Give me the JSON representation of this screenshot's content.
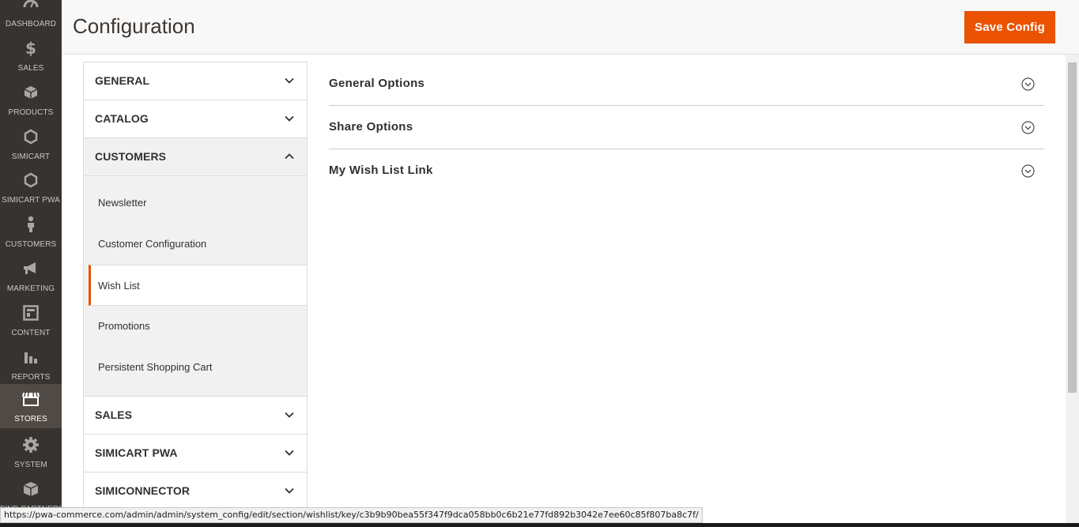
{
  "nav": {
    "items": [
      {
        "label": "DASHBOARD",
        "icon": "dashboard-icon"
      },
      {
        "label": "SALES",
        "icon": "dollar-icon"
      },
      {
        "label": "PRODUCTS",
        "icon": "cube-icon"
      },
      {
        "label": "SIMICART",
        "icon": "hexagon-icon"
      },
      {
        "label": "SIMICART PWA",
        "icon": "hexagon-icon"
      },
      {
        "label": "CUSTOMERS",
        "icon": "person-icon"
      },
      {
        "label": "MARKETING",
        "icon": "megaphone-icon"
      },
      {
        "label": "CONTENT",
        "icon": "layout-icon"
      },
      {
        "label": "REPORTS",
        "icon": "bar-chart-icon"
      },
      {
        "label": "STORES",
        "icon": "storefront-icon",
        "active": true
      },
      {
        "label": "SYSTEM",
        "icon": "gear-icon"
      },
      {
        "label": "FIND PARTNERS",
        "icon": "puzzle-icon"
      }
    ]
  },
  "header": {
    "title": "Configuration",
    "save_label": "Save Config"
  },
  "tabs": {
    "general": "GENERAL",
    "catalog": "CATALOG",
    "customers": "CUSTOMERS",
    "customers_items": [
      "Newsletter",
      "Customer Configuration",
      "Wish List",
      "Promotions",
      "Persistent Shopping Cart"
    ],
    "sales": "SALES",
    "simicart_pwa": "SIMICART PWA",
    "simiconnector": "SIMICONNECTOR"
  },
  "sections": [
    {
      "title": "General Options"
    },
    {
      "title": "Share Options"
    },
    {
      "title": "My Wish List Link"
    }
  ],
  "status_url": "https://pwa-commerce.com/admin/admin/system_config/edit/section/wishlist/key/c3b9b90bea55f347f9dca058bb0c6b21e77fd892b3042e7ee60c85f807ba8c7f/",
  "colors": {
    "accent": "#eb5202",
    "nav_bg": "#373330",
    "nav_active": "#514943"
  }
}
